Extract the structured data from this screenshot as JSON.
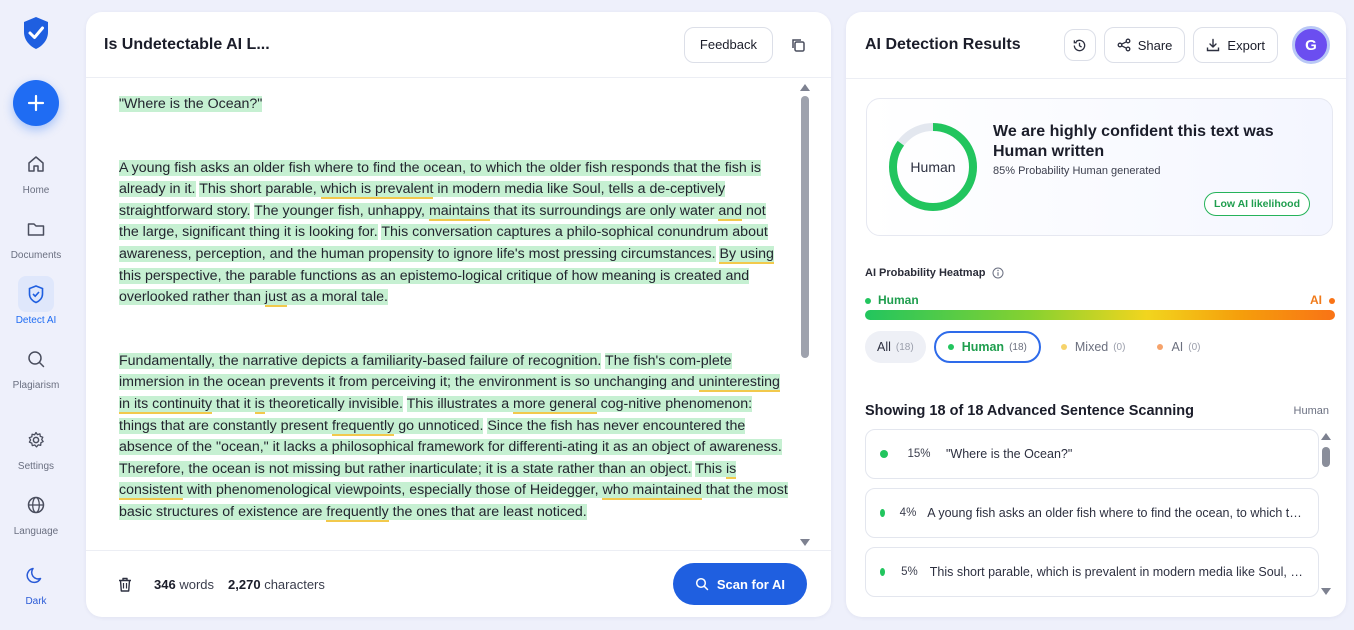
{
  "sidebar": {
    "new_label": "+",
    "items": [
      {
        "label": "Home",
        "icon": "home-icon"
      },
      {
        "label": "Documents",
        "icon": "folder-icon"
      },
      {
        "label": "Detect AI",
        "icon": "shield-check-icon",
        "active": true
      },
      {
        "label": "Plagiarism",
        "icon": "search-icon"
      },
      {
        "label": "Settings",
        "icon": "gear-icon"
      },
      {
        "label": "Language",
        "icon": "globe-icon"
      },
      {
        "label": "Dark",
        "icon": "moon-icon"
      }
    ]
  },
  "editor": {
    "title": "Is Undetectable AI L...",
    "feedback_label": "Feedback",
    "footer": {
      "words_count": "346",
      "words_label": "words",
      "chars_count": "2,270",
      "chars_label": "characters",
      "scan_label": "Scan for AI"
    }
  },
  "results": {
    "title": "AI Detection Results",
    "share_label": "Share",
    "export_label": "Export",
    "avatar_initial": "G",
    "verdict": {
      "donut_label": "Human",
      "human_probability": 85,
      "headline": "We are highly confident this text was Human written",
      "sub": "85% Probability Human generated",
      "badge": "Low AI likelihood"
    },
    "heatmap": {
      "title": "AI Probability Heatmap",
      "left_label": "Human",
      "right_label": "AI"
    },
    "filters": [
      {
        "label": "All",
        "count": "(18)"
      },
      {
        "label": "Human",
        "count": "(18)"
      },
      {
        "label": "Mixed",
        "count": "(0)"
      },
      {
        "label": "AI",
        "count": "(0)"
      }
    ],
    "scan_title": "Showing 18 of 18 Advanced Sentence Scanning",
    "scan_right": "Human",
    "sentences": [
      {
        "pct": "15%",
        "text": "\"Where is the Ocean?\""
      },
      {
        "pct": "4%",
        "text": "A young fish asks an older fish where to find the ocean, to which the older fish responds that the fish is already in it."
      },
      {
        "pct": "5%",
        "text": "This short parable, which is prevalent in modern media like Soul, tells a deceptively straightforward story."
      }
    ]
  },
  "colors": {
    "accent": "#1f5fe0",
    "human_green": "#22c55e",
    "ai_orange": "#f97316",
    "highlight": "#c6f0d2"
  }
}
